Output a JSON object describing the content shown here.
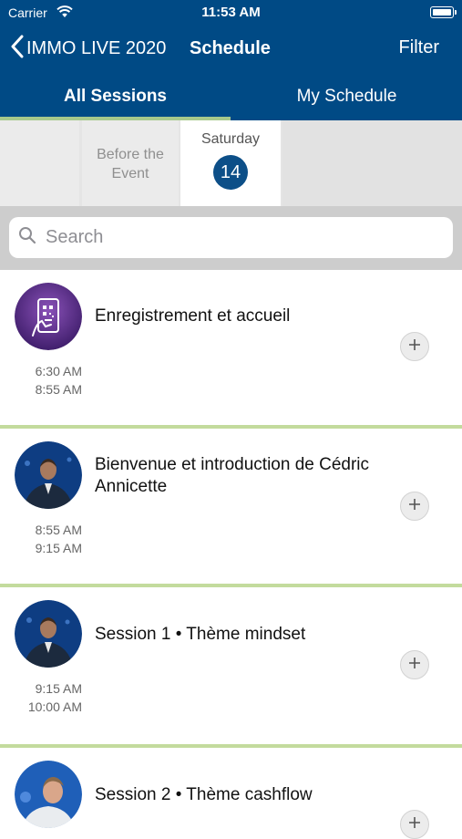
{
  "status_bar": {
    "carrier": "Carrier",
    "time": "11:53 AM"
  },
  "nav": {
    "back_label": "IMMO LIVE 2020",
    "title": "Schedule",
    "filter_label": "Filter"
  },
  "tabs": [
    {
      "label": "All Sessions",
      "active": true
    },
    {
      "label": "My Schedule",
      "active": false
    }
  ],
  "days": {
    "before": "Before the Event",
    "selected": {
      "weekday": "Saturday",
      "date": "14"
    }
  },
  "search": {
    "placeholder": "Search"
  },
  "sessions": [
    {
      "title": "Enregistrement et accueil",
      "start": "6:30 AM",
      "end": "8:55 AM",
      "icon": "phone-qr-icon"
    },
    {
      "title": "Bienvenue et introduction de Cédric Annicette",
      "start": "8:55 AM",
      "end": "9:15 AM",
      "icon": "speaker-photo"
    },
    {
      "title": "Session 1 • Thème mindset",
      "start": "9:15 AM",
      "end": "10:00 AM",
      "icon": "speaker-photo"
    },
    {
      "title": "Session 2 • Thème cashflow",
      "icon": "speaker-photo"
    }
  ],
  "colors": {
    "header": "#004a85",
    "accent": "#a7c98c",
    "badge": "#0d4f88",
    "divider": "#c3db9d"
  }
}
